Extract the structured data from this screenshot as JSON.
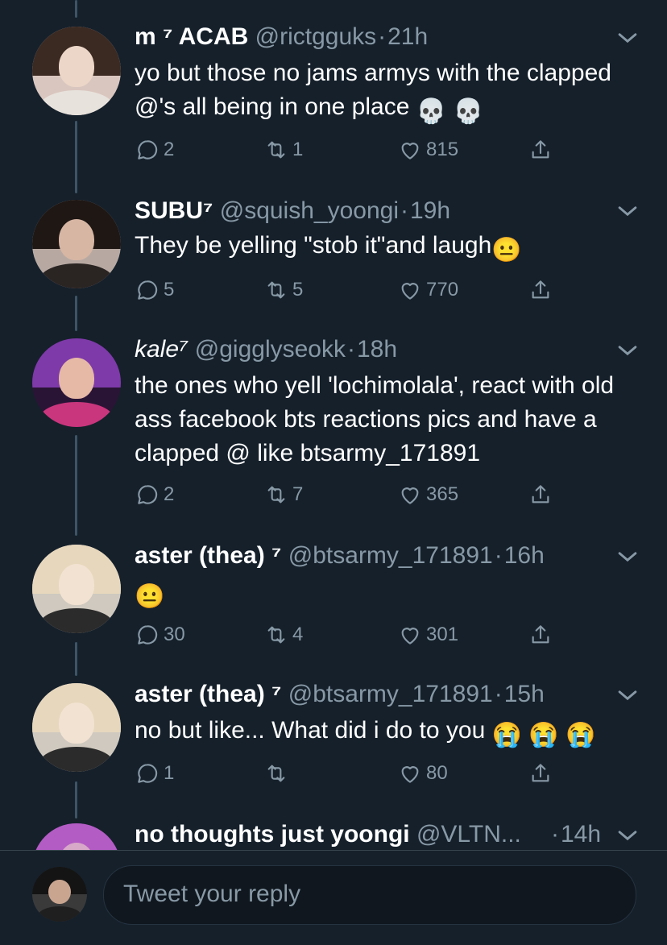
{
  "tweets": [
    {
      "name": "m ⁷ ACAB",
      "handle": "@rictgguks",
      "time": "21h",
      "text": "yo but those no jams armys with the clapped @'s all being in one place",
      "emojis": [
        "💀",
        "💀"
      ],
      "replies": "2",
      "retweets": "1",
      "likes": "815",
      "avatar_colors": {
        "bg": "#d9c6bf",
        "hair": "#3b2a22",
        "face": "#ecd6c8",
        "body": "#e8e2dc"
      }
    },
    {
      "name": "SUBU⁷",
      "handle": "@squish_yoongi",
      "time": "19h",
      "text": "They be yelling \"stob it\"and laugh",
      "emojis": [
        "😐"
      ],
      "replies": "5",
      "retweets": "5",
      "likes": "770",
      "avatar_colors": {
        "bg": "#b7a9a2",
        "hair": "#1e1714",
        "face": "#d7b6a4",
        "body": "#2a2423"
      }
    },
    {
      "name": "kale⁷",
      "handle": "@gigglyseokk",
      "time": "18h",
      "text": "the ones who yell 'lochimolala', react with old ass facebook bts reactions pics and have a clapped @ like btsarmy_171891",
      "emojis": [],
      "replies": "2",
      "retweets": "7",
      "likes": "365",
      "avatar_colors": {
        "bg": "#2a1436",
        "hair": "#7d3aa8",
        "face": "#e6b8a6",
        "body": "#c9367d"
      }
    },
    {
      "name": "aster (thea) ⁷",
      "handle": "@btsarmy_171891",
      "time": "16h",
      "text": "",
      "emojis": [
        "😐"
      ],
      "replies": "30",
      "retweets": "4",
      "likes": "301",
      "avatar_colors": {
        "bg": "#cfc9bf",
        "hair": "#e7d7bd",
        "face": "#f2e2d2",
        "body": "#2b2b2b"
      }
    },
    {
      "name": "aster (thea) ⁷",
      "handle": "@btsarmy_171891",
      "time": "15h",
      "text": "no but like... What did i do to you",
      "emojis": [
        "😭",
        "😭",
        "😭"
      ],
      "replies": "1",
      "retweets": "",
      "likes": "80",
      "avatar_colors": {
        "bg": "#cfc9bf",
        "hair": "#e7d7bd",
        "face": "#f2e2d2",
        "body": "#2b2b2b"
      }
    },
    {
      "name": "no thoughts just yoongi",
      "handle": "@VLTN...",
      "time": "14h",
      "text": "",
      "emojis": [],
      "replies": "",
      "retweets": "",
      "likes": "",
      "avatar_colors": {
        "bg": "#7a2f86",
        "hair": "#b35cc4",
        "face": "#d8a8c8",
        "body": "#5a2a6a"
      }
    }
  ],
  "reply_bar": {
    "placeholder": "Tweet your reply"
  },
  "colors": {
    "background": "#15202b",
    "secondary_text": "#8899a6",
    "thread_line": "#3d5466"
  },
  "icons": [
    "reply-icon",
    "retweet-icon",
    "like-icon",
    "share-icon",
    "chevron-down-icon"
  ]
}
